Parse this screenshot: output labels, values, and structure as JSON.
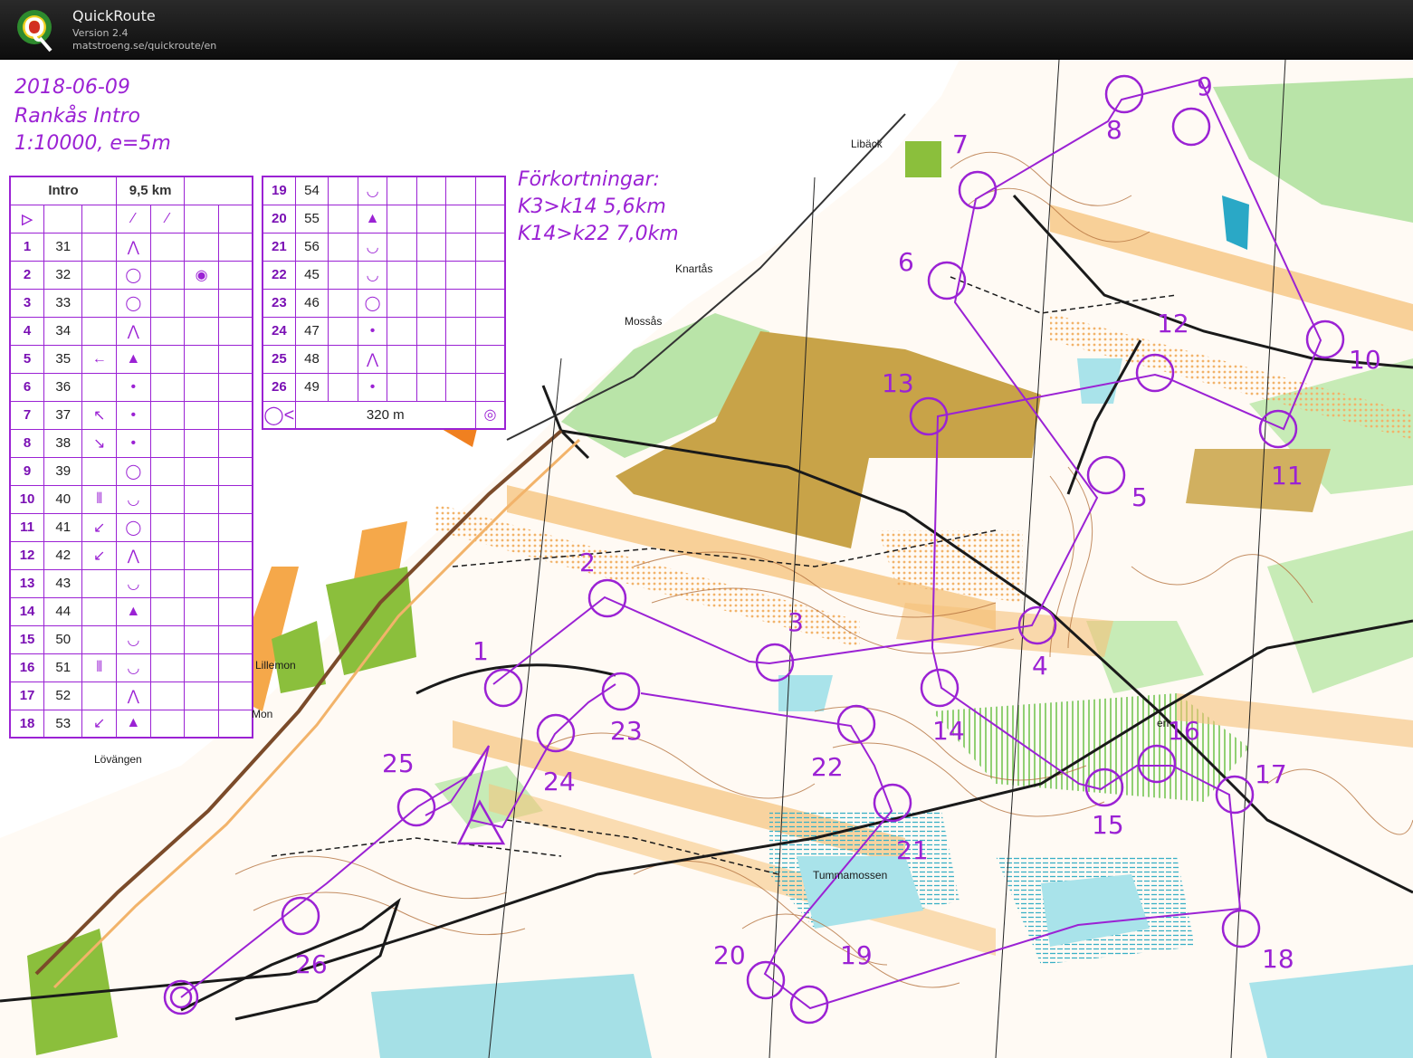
{
  "app": {
    "title": "QuickRoute",
    "version": "Version 2.4",
    "url": "matstroeng.se/quickroute/en"
  },
  "map_header": {
    "date": "2018-06-09",
    "event": "Rankås Intro",
    "scale": "1:10000, e=5m"
  },
  "shortcuts": {
    "title": "Förkortningar:",
    "line1": "K3>k14 5,6km",
    "line2": "K14>k22 7,0km"
  },
  "description_table": {
    "course": "Intro",
    "length": "9,5 km",
    "controls_left": [
      {
        "n": "1",
        "code": "31",
        "d": "",
        "f": "⋀",
        "x": ""
      },
      {
        "n": "2",
        "code": "32",
        "d": "",
        "f": "◯",
        "x": "◉"
      },
      {
        "n": "3",
        "code": "33",
        "d": "",
        "f": "◯",
        "x": ""
      },
      {
        "n": "4",
        "code": "34",
        "d": "",
        "f": "⋀",
        "x": ""
      },
      {
        "n": "5",
        "code": "35",
        "d": "←",
        "f": "▲",
        "x": ""
      },
      {
        "n": "6",
        "code": "36",
        "d": "",
        "f": "•",
        "x": ""
      },
      {
        "n": "7",
        "code": "37",
        "d": "↖",
        "f": "•",
        "x": ""
      },
      {
        "n": "8",
        "code": "38",
        "d": "↘",
        "f": "•",
        "x": ""
      },
      {
        "n": "9",
        "code": "39",
        "d": "",
        "f": "◯",
        "x": ""
      },
      {
        "n": "10",
        "code": "40",
        "d": "⦀",
        "f": "◡",
        "x": ""
      },
      {
        "n": "11",
        "code": "41",
        "d": "↙",
        "f": "◯",
        "x": ""
      },
      {
        "n": "12",
        "code": "42",
        "d": "↙",
        "f": "⋀",
        "x": ""
      },
      {
        "n": "13",
        "code": "43",
        "d": "",
        "f": "◡",
        "x": ""
      },
      {
        "n": "14",
        "code": "44",
        "d": "",
        "f": "▲",
        "x": ""
      },
      {
        "n": "15",
        "code": "50",
        "d": "",
        "f": "◡",
        "x": ""
      },
      {
        "n": "16",
        "code": "51",
        "d": "⦀",
        "f": "◡",
        "x": ""
      },
      {
        "n": "17",
        "code": "52",
        "d": "",
        "f": "⋀",
        "x": ""
      },
      {
        "n": "18",
        "code": "53",
        "d": "↙",
        "f": "▲",
        "x": ""
      }
    ],
    "controls_right": [
      {
        "n": "19",
        "code": "54",
        "f": "◡"
      },
      {
        "n": "20",
        "code": "55",
        "f": "▲"
      },
      {
        "n": "21",
        "code": "56",
        "f": "◡"
      },
      {
        "n": "22",
        "code": "45",
        "f": "◡"
      },
      {
        "n": "23",
        "code": "46",
        "f": "◯"
      },
      {
        "n": "24",
        "code": "47",
        "f": "•"
      },
      {
        "n": "25",
        "code": "48",
        "f": "⋀"
      },
      {
        "n": "26",
        "code": "49",
        "f": "•"
      }
    ],
    "finish_distance": "320 m"
  },
  "places": {
    "liback": "Libäck",
    "knartas": "Knartås",
    "mossas": "Mossås",
    "lillemon": "Lillemon",
    "mon": "Mon",
    "lovangen": "Lövängen",
    "tummamossen": "Tummamossen",
    "en": "en"
  },
  "controls": {
    "1": "1",
    "2": "2",
    "3": "3",
    "4": "4",
    "5": "5",
    "6": "6",
    "7": "7",
    "8": "8",
    "9": "9",
    "10": "10",
    "11": "11",
    "12": "12",
    "13": "13",
    "14": "14",
    "15": "15",
    "16": "16",
    "17": "17",
    "18": "18",
    "19": "19",
    "20": "20",
    "21": "21",
    "22": "22",
    "23": "23",
    "24": "24",
    "25": "25",
    "26": "26"
  },
  "colors": {
    "course": "#9b22d4",
    "vegetation_green": "#b9e4a8",
    "open_yellow": "#f5c27a",
    "rough_open": "#c8a348",
    "water": "#5ec8d4",
    "contour": "#b5733f"
  }
}
